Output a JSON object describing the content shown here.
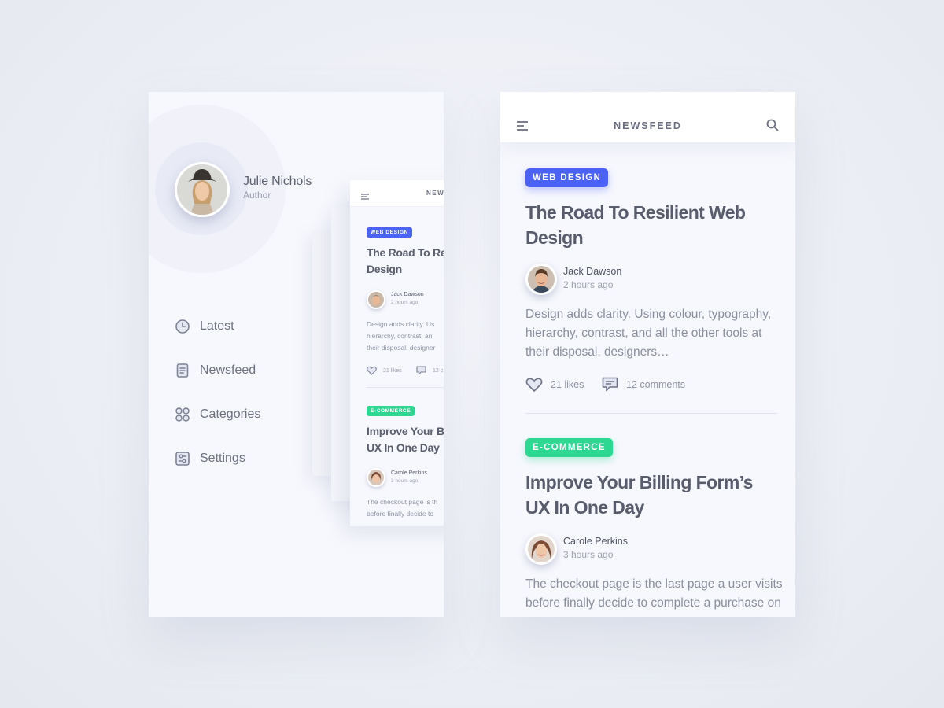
{
  "drawer": {
    "user": {
      "name": "Julie Nichols",
      "role": "Author"
    },
    "menu": [
      {
        "label": "Latest",
        "icon": "clock-icon"
      },
      {
        "label": "Newsfeed",
        "icon": "document-icon"
      },
      {
        "label": "Categories",
        "icon": "grid-icon"
      },
      {
        "label": "Settings",
        "icon": "sliders-icon"
      }
    ]
  },
  "preview": {
    "header_title": "NEWSF",
    "articles": [
      {
        "tag": "WEB DESIGN",
        "title": "The Road To Re\nDesign",
        "author": "Jack Dawson",
        "time": "2 hours ago",
        "excerpt": "Design adds clarity. Us\nhierarchy, contrast, an\ntheir disposal, designer",
        "likes": "21 likes",
        "comments": "12 c"
      },
      {
        "tag": "E-COMMERCE",
        "title": "Improve Your B\nUX In One Day",
        "author": "Carole Perkins",
        "time": "3 hours ago",
        "excerpt": "The checkout page is th\nbefore finally decide to"
      }
    ]
  },
  "newsfeed": {
    "header_title": "NEWSFEED",
    "articles": [
      {
        "tag": "WEB DESIGN",
        "tag_color": "#4a63f5",
        "title": "The Road To Resilient Web\nDesign",
        "author": "Jack Dawson",
        "time": "2 hours ago",
        "excerpt": "Design adds clarity. Using colour, typography,\nhierarchy, contrast, and all the other tools at\ntheir disposal, designers…",
        "likes": "21 likes",
        "comments": "12 comments"
      },
      {
        "tag": "E-COMMERCE",
        "tag_color": "#2fd892",
        "title": "Improve Your Billing Form’s\nUX In One Day",
        "author": "Carole Perkins",
        "time": "3 hours ago",
        "excerpt": "The checkout page is the last page a user visits\nbefore finally decide to complete a purchase on"
      }
    ]
  },
  "colors": {
    "accent_blue": "#4a63f5",
    "accent_green": "#2fd892",
    "text_primary": "#585c6c",
    "text_muted": "#9da1ae"
  }
}
